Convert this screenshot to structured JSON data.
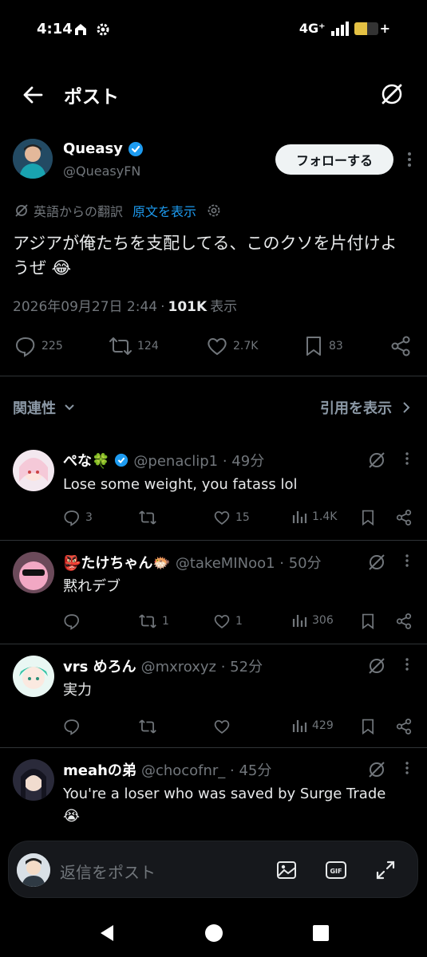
{
  "status_bar": {
    "time": "4:14",
    "network": "4G⁺",
    "battery_level": 0.55
  },
  "header": {
    "title": "ポスト"
  },
  "post": {
    "author_name": "Queasy",
    "author_handle": "@QueasyFN",
    "follow_label": "フォローする",
    "translated_from": "英語からの翻訳",
    "show_original": "原文を表示",
    "text": "アジアが俺たちを支配してる、このクソを片付けようぜ 😂",
    "timestamp": "2026年09月27日 2:44",
    "separator": "·",
    "views_count": "101K",
    "views_label": "表示",
    "replies": "225",
    "reposts": "124",
    "likes": "2.7K",
    "bookmarks": "83"
  },
  "sort": {
    "label": "関連性",
    "quotes_label": "引用を表示"
  },
  "replies": [
    {
      "name": "ぺな🍀",
      "verified": true,
      "handle_time": "@penaclip1 · 49分",
      "text": "Lose some weight, you fatass lol",
      "replies": "3",
      "reposts": "",
      "likes": "15",
      "views": "1.4K"
    },
    {
      "name": "👺たけちゃん🐡",
      "verified": false,
      "handle_time": "@takeMINoo1 · 50分",
      "text": "黙れデブ",
      "replies": "",
      "reposts": "1",
      "likes": "1",
      "views": "306"
    },
    {
      "name": "vrs めろん",
      "verified": false,
      "handle_time": "@mxroxyz · 52分",
      "text": "実力",
      "replies": "",
      "reposts": "",
      "likes": "",
      "views": "429"
    },
    {
      "name": "meahの弟",
      "verified": false,
      "handle_time": "@chocofnr_ · 45分",
      "text": "You're a loser who was saved by Surge Trade 😭"
    }
  ],
  "compose": {
    "placeholder": "返信をポスト"
  },
  "colors": {
    "accent": "#1d9bf0",
    "background": "#000000",
    "muted": "#71767b",
    "divider": "#2f3336"
  },
  "icons": [
    "back-arrow-icon",
    "grok-icon",
    "verified-badge-icon",
    "translate-icon",
    "settings-icon",
    "reply-icon",
    "repost-icon",
    "like-icon",
    "bookmark-icon",
    "share-icon",
    "views-icon",
    "image-icon",
    "gif-icon",
    "expand-icon"
  ]
}
